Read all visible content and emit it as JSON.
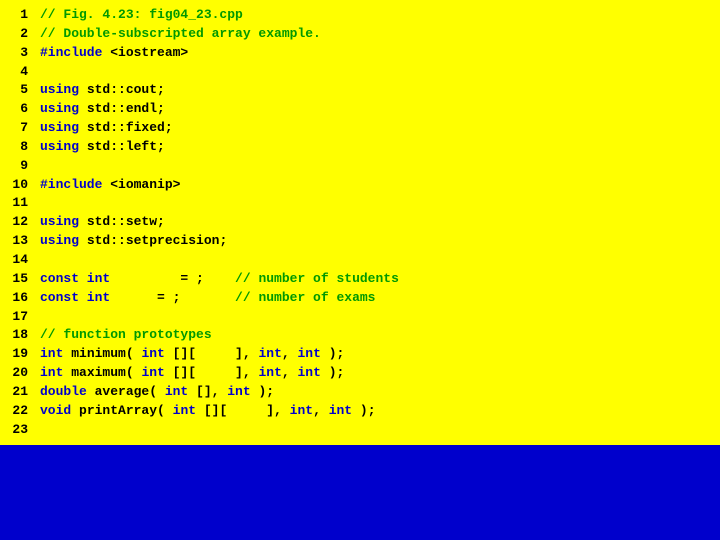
{
  "lines": [
    {
      "n": "1",
      "segs": [
        {
          "cls": "comment",
          "t": "// Fig. 4.23: fig04_23.cpp"
        }
      ]
    },
    {
      "n": "2",
      "segs": [
        {
          "cls": "comment",
          "t": "// Double-subscripted array example."
        }
      ]
    },
    {
      "n": "3",
      "segs": [
        {
          "cls": "keyword",
          "t": "#include "
        },
        {
          "cls": "identifier",
          "t": "<iostream>"
        }
      ]
    },
    {
      "n": "4",
      "segs": [
        {
          "cls": "plain",
          "t": ""
        }
      ]
    },
    {
      "n": "5",
      "segs": [
        {
          "cls": "keyword",
          "t": "using "
        },
        {
          "cls": "identifier",
          "t": "std::cout"
        },
        {
          "cls": "plain",
          "t": ";"
        }
      ]
    },
    {
      "n": "6",
      "segs": [
        {
          "cls": "keyword",
          "t": "using "
        },
        {
          "cls": "identifier",
          "t": "std::endl"
        },
        {
          "cls": "plain",
          "t": ";"
        }
      ]
    },
    {
      "n": "7",
      "segs": [
        {
          "cls": "keyword",
          "t": "using "
        },
        {
          "cls": "identifier",
          "t": "std::fixed"
        },
        {
          "cls": "plain",
          "t": ";"
        }
      ]
    },
    {
      "n": "8",
      "segs": [
        {
          "cls": "keyword",
          "t": "using "
        },
        {
          "cls": "identifier",
          "t": "std::left"
        },
        {
          "cls": "plain",
          "t": ";"
        }
      ]
    },
    {
      "n": "9",
      "segs": [
        {
          "cls": "plain",
          "t": ""
        }
      ]
    },
    {
      "n": "10",
      "segs": [
        {
          "cls": "keyword",
          "t": "#include "
        },
        {
          "cls": "identifier",
          "t": "<iomanip>"
        }
      ]
    },
    {
      "n": "11",
      "segs": [
        {
          "cls": "plain",
          "t": ""
        }
      ]
    },
    {
      "n": "12",
      "segs": [
        {
          "cls": "keyword",
          "t": "using "
        },
        {
          "cls": "identifier",
          "t": "std::setw"
        },
        {
          "cls": "plain",
          "t": ";"
        }
      ]
    },
    {
      "n": "13",
      "segs": [
        {
          "cls": "keyword",
          "t": "using "
        },
        {
          "cls": "identifier",
          "t": "std::setprecision"
        },
        {
          "cls": "plain",
          "t": ";"
        }
      ]
    },
    {
      "n": "14",
      "segs": [
        {
          "cls": "plain",
          "t": ""
        }
      ]
    },
    {
      "n": "15",
      "segs": [
        {
          "cls": "keyword",
          "t": "const int "
        },
        {
          "cls": "plain",
          "t": "        = ;    "
        },
        {
          "cls": "comment",
          "t": "// number of students"
        }
      ]
    },
    {
      "n": "16",
      "segs": [
        {
          "cls": "keyword",
          "t": "const int "
        },
        {
          "cls": "plain",
          "t": "     = ;       "
        },
        {
          "cls": "comment",
          "t": "// number of exams"
        }
      ]
    },
    {
      "n": "17",
      "segs": [
        {
          "cls": "plain",
          "t": ""
        }
      ]
    },
    {
      "n": "18",
      "segs": [
        {
          "cls": "comment",
          "t": "// function prototypes"
        }
      ]
    },
    {
      "n": "19",
      "segs": [
        {
          "cls": "keyword",
          "t": "int "
        },
        {
          "cls": "identifier",
          "t": "minimum"
        },
        {
          "cls": "plain",
          "t": "( "
        },
        {
          "cls": "keyword",
          "t": "int"
        },
        {
          "cls": "plain",
          "t": " [][     ], "
        },
        {
          "cls": "keyword",
          "t": "int"
        },
        {
          "cls": "plain",
          "t": ", "
        },
        {
          "cls": "keyword",
          "t": "int"
        },
        {
          "cls": "plain",
          "t": " );"
        }
      ]
    },
    {
      "n": "20",
      "segs": [
        {
          "cls": "keyword",
          "t": "int "
        },
        {
          "cls": "identifier",
          "t": "maximum"
        },
        {
          "cls": "plain",
          "t": "( "
        },
        {
          "cls": "keyword",
          "t": "int"
        },
        {
          "cls": "plain",
          "t": " [][     ], "
        },
        {
          "cls": "keyword",
          "t": "int"
        },
        {
          "cls": "plain",
          "t": ", "
        },
        {
          "cls": "keyword",
          "t": "int"
        },
        {
          "cls": "plain",
          "t": " );"
        }
      ]
    },
    {
      "n": "21",
      "segs": [
        {
          "cls": "keyword",
          "t": "double "
        },
        {
          "cls": "identifier",
          "t": "average"
        },
        {
          "cls": "plain",
          "t": "( "
        },
        {
          "cls": "keyword",
          "t": "int"
        },
        {
          "cls": "plain",
          "t": " [], "
        },
        {
          "cls": "keyword",
          "t": "int"
        },
        {
          "cls": "plain",
          "t": " );"
        }
      ]
    },
    {
      "n": "22",
      "segs": [
        {
          "cls": "keyword",
          "t": "void "
        },
        {
          "cls": "identifier",
          "t": "printArray"
        },
        {
          "cls": "plain",
          "t": "( "
        },
        {
          "cls": "keyword",
          "t": "int"
        },
        {
          "cls": "plain",
          "t": " [][     ], "
        },
        {
          "cls": "keyword",
          "t": "int"
        },
        {
          "cls": "plain",
          "t": ", "
        },
        {
          "cls": "keyword",
          "t": "int"
        },
        {
          "cls": "plain",
          "t": " );"
        }
      ]
    },
    {
      "n": "23",
      "segs": [
        {
          "cls": "plain",
          "t": ""
        }
      ]
    }
  ]
}
